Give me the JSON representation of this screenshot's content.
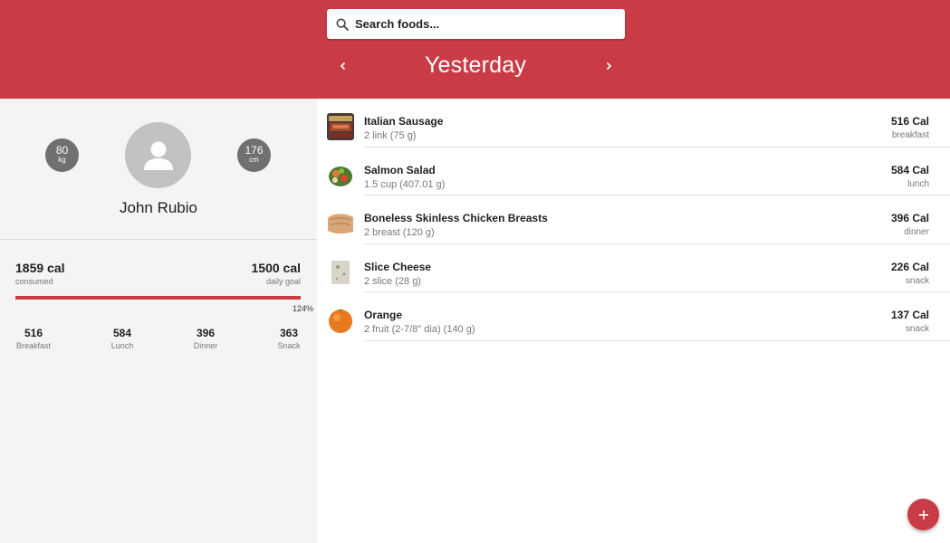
{
  "header": {
    "search_placeholder": "Search foods...",
    "date_title": "Yesterday",
    "prev_icon": "chevron-left-icon",
    "next_icon": "chevron-right-icon",
    "color": "#c93c46"
  },
  "profile": {
    "name": "John Rubio",
    "weight": {
      "value": "80",
      "unit": "kg"
    },
    "height": {
      "value": "176",
      "unit": "cm"
    },
    "avatar_icon": "person-icon"
  },
  "calories": {
    "consumed": "1859 cal",
    "consumed_label": "consumed",
    "goal": "1500 cal",
    "goal_label": "daily goal",
    "percent": "124%",
    "progress_fraction": 1.0
  },
  "meals": [
    {
      "value": "516",
      "label": "Breakfast"
    },
    {
      "value": "584",
      "label": "Lunch"
    },
    {
      "value": "396",
      "label": "Dinner"
    },
    {
      "value": "363",
      "label": "Snack"
    }
  ],
  "foods": [
    {
      "name": "Italian Sausage",
      "portion": "2 link (75 g)",
      "calories": "516 Cal",
      "meal": "breakfast",
      "thumb": "sausage-package-thumbnail"
    },
    {
      "name": "Salmon Salad",
      "portion": "1.5 cup (407.01 g)",
      "calories": "584 Cal",
      "meal": "lunch",
      "thumb": "salad-bowl-thumbnail"
    },
    {
      "name": "Boneless Skinless Chicken Breasts",
      "portion": "2 breast (120 g)",
      "calories": "396 Cal",
      "meal": "dinner",
      "thumb": "chicken-breast-thumbnail"
    },
    {
      "name": "Slice Cheese",
      "portion": "2 slice (28 g)",
      "calories": "226 Cal",
      "meal": "snack",
      "thumb": "cheese-slice-thumbnail"
    },
    {
      "name": "Orange",
      "portion": "2 fruit (2-7/8\" dia) (140 g)",
      "calories": "137 Cal",
      "meal": "snack",
      "thumb": "orange-thumbnail"
    }
  ],
  "fab_icon": "plus-icon"
}
